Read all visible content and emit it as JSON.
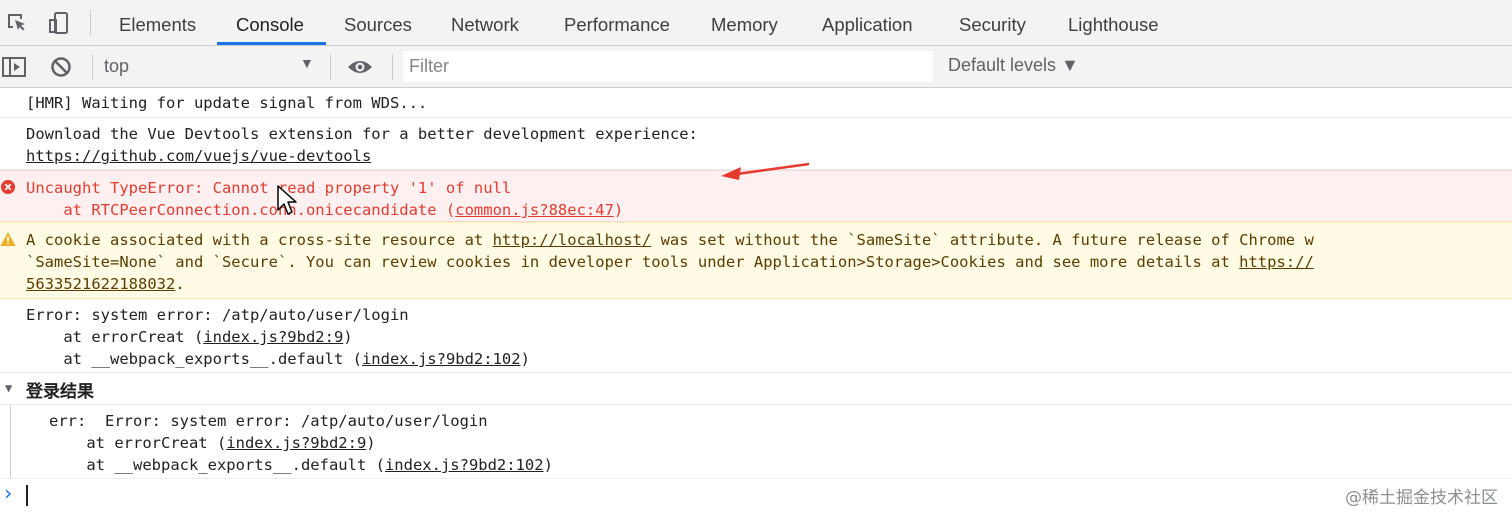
{
  "tabs": [
    {
      "label": "Elements",
      "active": false
    },
    {
      "label": "Console",
      "active": true
    },
    {
      "label": "Sources",
      "active": false
    },
    {
      "label": "Network",
      "active": false
    },
    {
      "label": "Performance",
      "active": false
    },
    {
      "label": "Memory",
      "active": false
    },
    {
      "label": "Application",
      "active": false
    },
    {
      "label": "Security",
      "active": false
    },
    {
      "label": "Lighthouse",
      "active": false
    }
  ],
  "toolbar": {
    "context": "top",
    "filter_placeholder": "Filter",
    "filter_value": "",
    "levels": "Default levels ▼"
  },
  "console": {
    "hmr": "[HMR] Waiting for update signal from WDS...",
    "devtools_line1": "Download the Vue Devtools extension for a better development experience:",
    "devtools_link": "https://github.com/vuejs/vue-devtools",
    "error": {
      "line1": "Uncaught TypeError: Cannot read property '1' of null",
      "line2_prefix": "    at RTCPeerConnection.conn.onicecandidate (",
      "line2_link": "common.js?88ec:47",
      "line2_suffix": ")"
    },
    "warning": {
      "l1_a": "A cookie associated with a cross-site resource at ",
      "l1_link": "http://localhost/",
      "l1_b": " was set without the `SameSite` attribute. A future release of Chrome w",
      "l2_a": "`SameSite=None` and `Secure`. You can review cookies in developer tools under Application>Storage>Cookies and see more details at ",
      "l2_link": "https://",
      "l3_link": "5633521622188032",
      "l3_b": "."
    },
    "system_error": {
      "line1": "Error: system error: /atp/auto/user/login",
      "line2_prefix": "    at errorCreat (",
      "line2_link": "index.js?9bd2:9",
      "line2_suffix": ")",
      "line3_prefix": "    at __webpack_exports__.default (",
      "line3_link": "index.js?9bd2:102",
      "line3_suffix": ")"
    },
    "group": {
      "title": "登录结果",
      "line1": "err:  Error: system error: /atp/auto/user/login",
      "line2_prefix": "    at errorCreat (",
      "line2_link": "index.js?9bd2:9",
      "line2_suffix": ")",
      "line3_prefix": "    at __webpack_exports__.default (",
      "line3_link": "index.js?9bd2:102",
      "line3_suffix": ")"
    },
    "prompt_symbol": "›"
  },
  "watermark": "@稀土掘金技术社区",
  "colors": {
    "accent": "#1a73e8",
    "error_text": "#e43c30",
    "error_bg": "#fef0f0",
    "warning_bg": "#fffbe5",
    "warning_icon": "#f2ab26",
    "annotation_arrow": "#e8392f"
  },
  "icons": [
    "inspect-element-icon",
    "device-toggle-icon",
    "sidebar-toggle-icon",
    "clear-console-icon",
    "eye-icon",
    "error-icon",
    "warning-icon",
    "expand-triangle-icon",
    "mouse-cursor-icon",
    "red-arrow-annotation"
  ]
}
